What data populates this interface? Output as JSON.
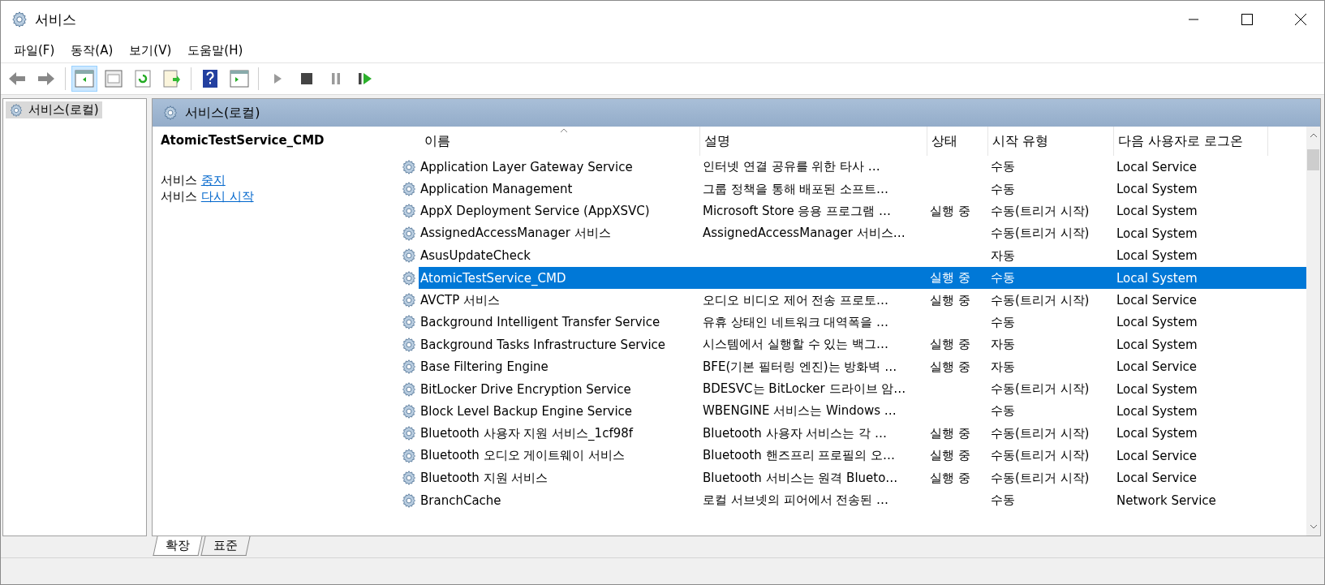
{
  "window": {
    "title": "서비스"
  },
  "menu": [
    "파일(F)",
    "동작(A)",
    "보기(V)",
    "도움말(H)"
  ],
  "toolbar": [
    {
      "kind": "back",
      "on": false
    },
    {
      "kind": "forward",
      "on": false
    },
    {
      "kind": "separator"
    },
    {
      "kind": "console-tree",
      "on": true
    },
    {
      "kind": "properties",
      "on": false
    },
    {
      "kind": "refresh",
      "on": false
    },
    {
      "kind": "export",
      "on": false
    },
    {
      "kind": "separator"
    },
    {
      "kind": "help",
      "on": false
    },
    {
      "kind": "action-pane",
      "on": false
    },
    {
      "kind": "separator"
    },
    {
      "kind": "start",
      "disabled": true,
      "on": false
    },
    {
      "kind": "stop",
      "disabled": false,
      "on": false
    },
    {
      "kind": "pause",
      "disabled": true,
      "on": false
    },
    {
      "kind": "resume",
      "disabled": false,
      "on": false
    }
  ],
  "tree": {
    "items": [
      {
        "label": "서비스(로컬)",
        "selected": true
      }
    ]
  },
  "pane": {
    "title": "서비스(로컬)",
    "service_name": "AtomicTestService_CMD",
    "actions": [
      {
        "text": "서비스",
        "link": "중지"
      },
      {
        "text": "서비스",
        "link": "다시 시작"
      }
    ]
  },
  "table": {
    "columns": [
      {
        "label": "이름",
        "sorted": true
      },
      {
        "label": "설명",
        "sorted": false
      },
      {
        "label": "상태",
        "sorted": false
      },
      {
        "label": "시작 유형",
        "sorted": false
      },
      {
        "label": "다음 사용자로 로그온",
        "sorted": false
      }
    ],
    "rows": [
      {
        "name": "Application Layer Gateway Service",
        "description": "인터넷 연결 공유를 위한 타사 …",
        "status": "",
        "startup": "수동",
        "logon": "Local Service",
        "selected": false
      },
      {
        "name": "Application Management",
        "description": "그룹 정책을 통해 배포된 소프트…",
        "status": "",
        "startup": "수동",
        "logon": "Local System",
        "selected": false
      },
      {
        "name": "AppX Deployment Service (AppXSVC)",
        "description": "Microsoft Store 응용 프로그램 …",
        "status": "실행 중",
        "startup": "수동(트리거 시작)",
        "logon": "Local System",
        "selected": false
      },
      {
        "name": "AssignedAccessManager 서비스",
        "description": "AssignedAccessManager 서비스…",
        "status": "",
        "startup": "수동(트리거 시작)",
        "logon": "Local System",
        "selected": false
      },
      {
        "name": "AsusUpdateCheck",
        "description": "",
        "status": "",
        "startup": "자동",
        "logon": "Local System",
        "selected": false
      },
      {
        "name": "AtomicTestService_CMD",
        "description": "",
        "status": "실행 중",
        "startup": "수동",
        "logon": "Local System",
        "selected": true
      },
      {
        "name": "AVCTP 서비스",
        "description": "오디오 비디오 제어 전송 프로토…",
        "status": "실행 중",
        "startup": "수동(트리거 시작)",
        "logon": "Local Service",
        "selected": false
      },
      {
        "name": "Background Intelligent Transfer Service",
        "description": "유휴 상태인 네트워크 대역폭을 …",
        "status": "",
        "startup": "수동",
        "logon": "Local System",
        "selected": false
      },
      {
        "name": "Background Tasks Infrastructure Service",
        "description": "시스템에서 실행할 수 있는 백그…",
        "status": "실행 중",
        "startup": "자동",
        "logon": "Local System",
        "selected": false
      },
      {
        "name": "Base Filtering Engine",
        "description": "BFE(기본 필터링 엔진)는 방화벽 …",
        "status": "실행 중",
        "startup": "자동",
        "logon": "Local Service",
        "selected": false
      },
      {
        "name": "BitLocker Drive Encryption Service",
        "description": "BDESVC는 BitLocker 드라이브 암…",
        "status": "",
        "startup": "수동(트리거 시작)",
        "logon": "Local System",
        "selected": false
      },
      {
        "name": "Block Level Backup Engine Service",
        "description": "WBENGINE 서비스는 Windows …",
        "status": "",
        "startup": "수동",
        "logon": "Local System",
        "selected": false
      },
      {
        "name": "Bluetooth 사용자 지원 서비스_1cf98f",
        "description": "Bluetooth 사용자 서비스는 각 …",
        "status": "실행 중",
        "startup": "수동(트리거 시작)",
        "logon": "Local System",
        "selected": false
      },
      {
        "name": "Bluetooth 오디오 게이트웨이 서비스",
        "description": "Bluetooth 핸즈프리 프로필의 오…",
        "status": "실행 중",
        "startup": "수동(트리거 시작)",
        "logon": "Local Service",
        "selected": false
      },
      {
        "name": "Bluetooth 지원 서비스",
        "description": "Bluetooth 서비스는 원격 Blueto…",
        "status": "실행 중",
        "startup": "수동(트리거 시작)",
        "logon": "Local Service",
        "selected": false
      },
      {
        "name": "BranchCache",
        "description": "로컬 서브넷의 피어에서 전송된 …",
        "status": "",
        "startup": "수동",
        "logon": "Network Service",
        "selected": false
      }
    ]
  },
  "view_tabs": [
    {
      "label": "확장",
      "selected": true
    },
    {
      "label": "표준",
      "selected": false
    }
  ]
}
